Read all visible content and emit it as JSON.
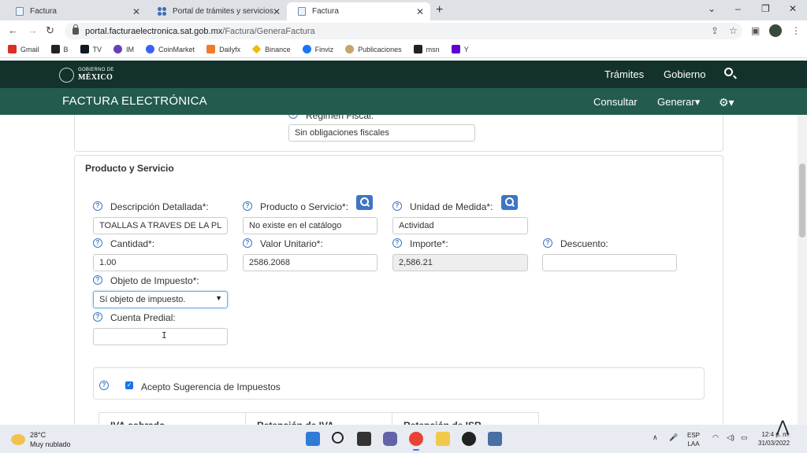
{
  "browser": {
    "tabs": [
      {
        "label": "Factura",
        "icon": "document-icon",
        "active": false
      },
      {
        "label": "Portal de trámites y servicios - SA",
        "icon": "grid-icon",
        "active": false
      },
      {
        "label": "Factura",
        "icon": "document-icon",
        "active": true
      }
    ],
    "url_host": "portal.facturaelectronica.sat.gob.mx",
    "url_path": "/Factura/GeneraFactura",
    "bookmarks": [
      {
        "label": "Gmail",
        "color": "#d93025"
      },
      {
        "label": "B",
        "color": "#222222"
      },
      {
        "label": "TV",
        "color": "#131722"
      },
      {
        "label": "IM",
        "color": "#6a3fb5"
      },
      {
        "label": "CoinMarket",
        "color": "#3861fb"
      },
      {
        "label": "Dailyfx",
        "color": "#f07b2a"
      },
      {
        "label": "Binance",
        "color": "#f0b90b"
      },
      {
        "label": "Finviz",
        "color": "#1877f2"
      },
      {
        "label": "Publicaciones",
        "color": "#c8a46a"
      },
      {
        "label": "msn",
        "color": "#222222"
      },
      {
        "label": "Y",
        "color": "#6001d2"
      }
    ]
  },
  "header": {
    "gob_top": "GOBIERNO DE",
    "gob_bottom": "MÉXICO",
    "nav": [
      "Trámites",
      "Gobierno"
    ],
    "title": "FACTURA ELECTRÓNICA",
    "actions": [
      "Consultar",
      "Generar▾"
    ]
  },
  "form": {
    "regimen_label": "Régimen Fiscal:",
    "regimen_value": "Sin obligaciones fiscales",
    "section_title": "Producto y Servicio",
    "descripcion_label": "Descripción Detallada*:",
    "descripcion_value": "TOALLAS A TRAVES DE LA PL",
    "producto_label": "Producto o Servicio*:",
    "producto_value": "No existe en el catálogo",
    "unidad_label": "Unidad de Medida*:",
    "unidad_value": "Actividad",
    "cantidad_label": "Cantidad*:",
    "cantidad_value": "1.00",
    "valor_label": "Valor Unitario*:",
    "valor_value": "2586.2068",
    "importe_label": "Importe*:",
    "importe_value": "2,586.21",
    "descuento_label": "Descuento:",
    "descuento_value": "",
    "objeto_label": "Objeto de Impuesto*:",
    "objeto_value": "Sí objeto de impuesto.",
    "cuenta_label": "Cuenta Predial:",
    "cuenta_value": "",
    "sugerencia_label": "Acepto Sugerencia de Impuestos",
    "sugerencia_checked": true,
    "table_headers": [
      "IVA cobrado",
      "Retención de IVA",
      "Retención de ISR"
    ]
  },
  "taskbar": {
    "temp": "28°C",
    "weather": "Muy nublado",
    "lang_top": "ESP",
    "lang_bottom": "LAA",
    "time": "12:4  p. m.",
    "date": "31/03/2022"
  }
}
